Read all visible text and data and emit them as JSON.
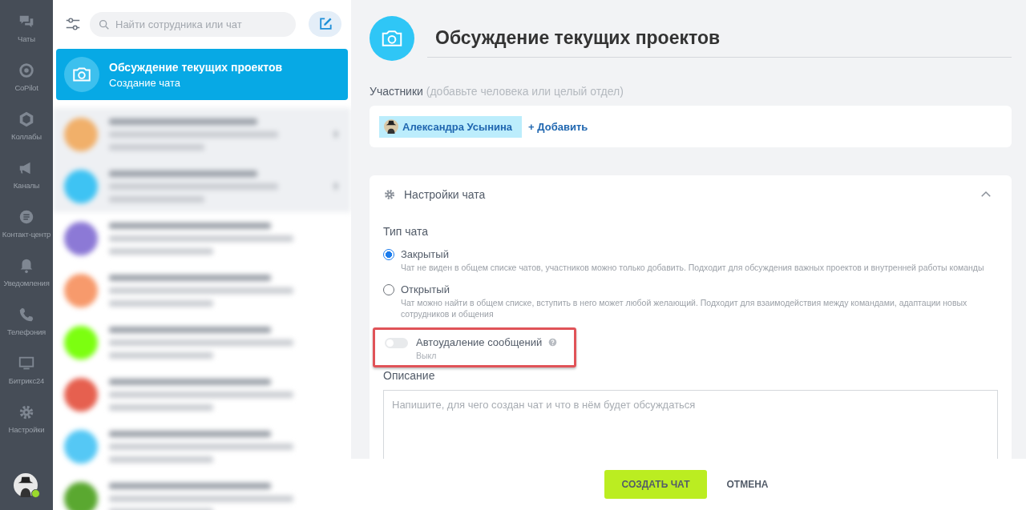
{
  "rail": {
    "items": [
      {
        "kind": "chats",
        "label": "Чаты"
      },
      {
        "kind": "copilot",
        "label": "CoPilot"
      },
      {
        "kind": "collabs",
        "label": "Коллабы"
      },
      {
        "kind": "channels",
        "label": "Каналы"
      },
      {
        "kind": "contact",
        "label": "Контакт-центр"
      },
      {
        "kind": "bell",
        "label": "Уведомления"
      },
      {
        "kind": "phone",
        "label": "Телефония"
      },
      {
        "kind": "monitor",
        "label": "Битрикс24"
      },
      {
        "kind": "gear",
        "label": "Настройки"
      }
    ],
    "user_online": true
  },
  "chat_list": {
    "search": {
      "placeholder": "Найти сотрудника или чат"
    },
    "new_chat": {
      "title": "Обсуждение текущих проектов",
      "subtitle": "Создание чата"
    },
    "blurred_items": [
      {
        "color": "#f1b06a",
        "pinned": true
      },
      {
        "color": "#3ec3f3",
        "pinned": true
      },
      {
        "color": "#8c79d6",
        "pinned": false
      },
      {
        "color": "#f79a6c",
        "pinned": false
      },
      {
        "color": "#7cff10",
        "pinned": false
      },
      {
        "color": "#e6604f",
        "pinned": false
      },
      {
        "color": "#55c8f5",
        "pinned": false
      },
      {
        "color": "#5aa830",
        "pinned": false
      }
    ]
  },
  "form": {
    "title": "Обсуждение текущих проектов",
    "participants": {
      "label": "Участники",
      "hint": "(добавьте человека или целый отдел)",
      "members": [
        "Александра Усынина"
      ],
      "add": "+ Добавить"
    },
    "settings": {
      "title": "Настройки чата",
      "expanded": true,
      "type_label": "Тип чата",
      "types": [
        {
          "label": "Закрытый",
          "description": "Чат не виден в общем списке чатов, участников можно только добавить. Подходит для обсуждения важных проектов и внутренней работы команды",
          "selected": true
        },
        {
          "label": "Открытый",
          "description": "Чат можно найти в общем списке, вступить в него может любой желающий. Подходит для взаимодействия между командами, адаптации новых сотрудников и общения",
          "selected": false
        }
      ],
      "autodelete": {
        "label": "Автоудаление сообщений",
        "state": "Выкл",
        "on": false,
        "highlighted": true
      },
      "description": {
        "label": "Описание",
        "placeholder": "Напишите, для чего создан чат и что в нём будет обсуждаться"
      }
    },
    "buttons": {
      "create": "СОЗДАТЬ ЧАТ",
      "cancel": "ОТМЕНА"
    }
  }
}
